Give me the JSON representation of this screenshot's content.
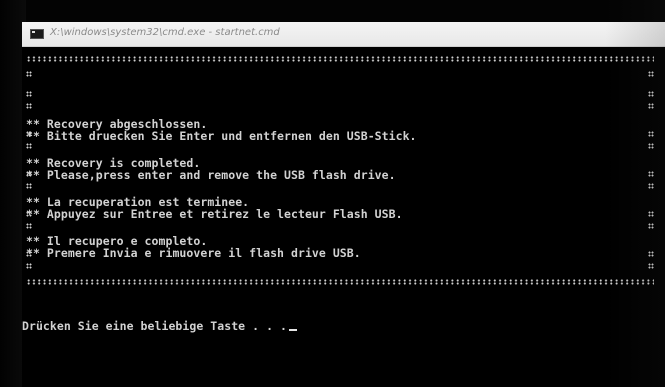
{
  "window": {
    "title": "X:\\windows\\system32\\cmd.exe - startnet.cmd",
    "icon": "console-icon"
  },
  "console": {
    "messages": [
      {
        "line1": "Recovery abgeschlossen.",
        "line2": "Bitte druecken Sie Enter und entfernen den USB-Stick."
      },
      {
        "line1": "Recovery is completed.",
        "line2": "Please,press enter and remove the USB flash drive."
      },
      {
        "line1": "La recuperation est terminee.",
        "line2": "Appuyez sur Entree et retirez le lecteur Flash USB."
      },
      {
        "line1": "Il recupero e completo.",
        "line2": "Premere Invia e rimuovere il flash drive USB."
      }
    ],
    "prompt": "Drücken Sie eine beliebige Taste . . ."
  }
}
